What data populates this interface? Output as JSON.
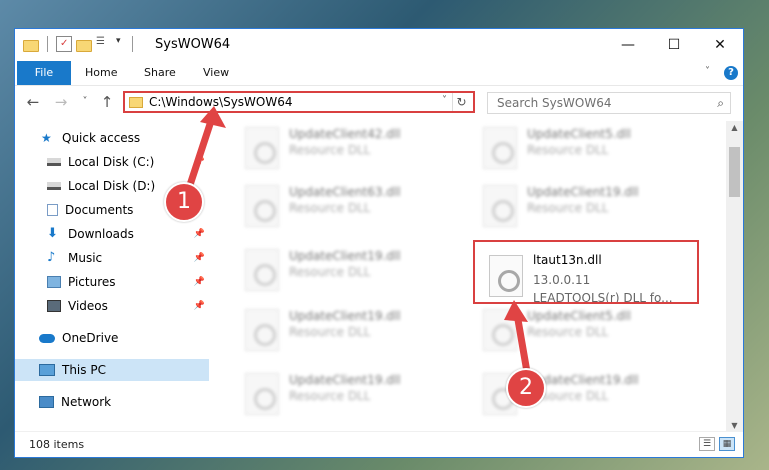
{
  "window": {
    "title": "SysWOW64",
    "minimize": "—",
    "maximize": "☐",
    "close": "✕"
  },
  "ribbon": {
    "tabs": [
      "File",
      "Home",
      "Share",
      "View"
    ],
    "help": "?"
  },
  "navigation": {
    "back": "←",
    "forward": "→",
    "recent": "˅",
    "up": "↑",
    "address": "C:\\Windows\\SysWOW64",
    "search_placeholder": "Search SysWOW64"
  },
  "sidebar": {
    "items": [
      {
        "label": "Quick access",
        "icon": "star-icon"
      },
      {
        "label": "Local Disk (C:)",
        "icon": "drive-icon"
      },
      {
        "label": "Local Disk (D:)",
        "icon": "drive-icon"
      },
      {
        "label": "Documents",
        "icon": "documents-icon"
      },
      {
        "label": "Downloads",
        "icon": "download-icon"
      },
      {
        "label": "Music",
        "icon": "music-icon"
      },
      {
        "label": "Pictures",
        "icon": "pictures-icon"
      },
      {
        "label": "Videos",
        "icon": "videos-icon"
      },
      {
        "label": "OneDrive",
        "icon": "cloud-icon"
      },
      {
        "label": "This PC",
        "icon": "computer-icon"
      },
      {
        "label": "Network",
        "icon": "network-icon"
      }
    ]
  },
  "files": {
    "col1": [
      {
        "name": "UpdateClient42.dll",
        "type": "Resource DLL"
      },
      {
        "name": "UpdateClient63.dll",
        "type": "Resource DLL"
      },
      {
        "name": "UpdateClient19.dll",
        "type": "Resource DLL"
      },
      {
        "name": "UpdateClient19.dll",
        "type": "Resource DLL"
      },
      {
        "name": "UpdateClient19.dll",
        "type": "Resource DLL"
      }
    ],
    "col2": [
      {
        "name": "UpdateClient5.dll",
        "type": "Resource DLL"
      },
      {
        "name": "UpdateClient19.dll",
        "type": "Resource DLL"
      },
      {
        "name": "UpdateClient5.dll",
        "type": "Resource DLL"
      },
      {
        "name": "UpdateClient19.dll",
        "type": "Resource DLL"
      }
    ],
    "selected": {
      "name": "ltaut13n.dll",
      "version": "13.0.0.11",
      "description": "LEADTOOLS(r) DLL fo..."
    }
  },
  "status": {
    "item_count": "108 items"
  },
  "callouts": [
    "1",
    "2"
  ],
  "colors": {
    "accent": "#1979ca",
    "highlight": "#d94040",
    "selection": "#cce4f7"
  }
}
